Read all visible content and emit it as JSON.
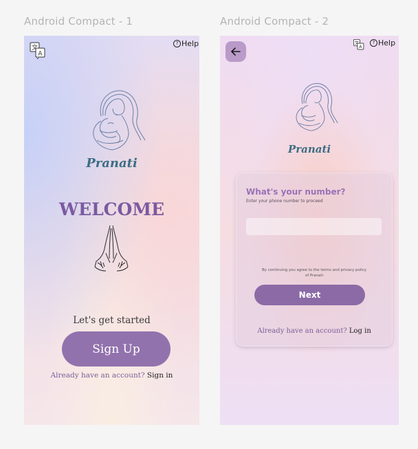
{
  "frames": {
    "frame1_label": "Android Compact - 1",
    "frame2_label": "Android Compact - 2"
  },
  "screen1": {
    "help_label": "Help",
    "brand": "Pranati",
    "welcome": "WELCOME",
    "tagline": "Let's get started",
    "signup_label": "Sign Up",
    "already_text": "Already have an account?",
    "signin_link": "Sign in"
  },
  "screen2": {
    "help_label": "Help",
    "brand": "Pranati",
    "card_title": "What's your number?",
    "card_subtitle": "Enter your phone number to proceed",
    "phone_value": "",
    "terms_line1": "By continuing you agree to the terms and privacy policy",
    "terms_line2": "of Pranati",
    "next_label": "Next",
    "already_text": "Already have an account?",
    "login_link": "Log in"
  },
  "colors": {
    "accent_purple": "#9272ad",
    "brand_teal": "#3b6d84",
    "welcome_purple": "#7b5aa0"
  },
  "icons": {
    "translate": "translate-icon",
    "help": "help-circle-icon",
    "back": "arrow-left-icon",
    "logo": "mother-child-logo-icon",
    "namaste": "namaste-hands-icon"
  }
}
